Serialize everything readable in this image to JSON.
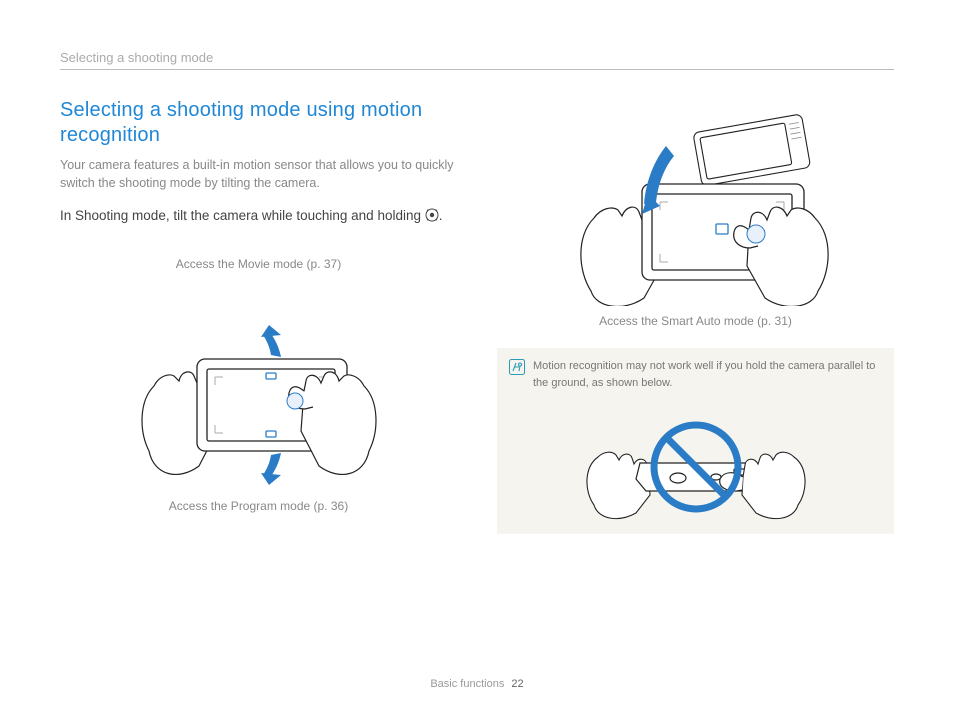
{
  "header": {
    "running_title": "Selecting a shooting mode"
  },
  "section": {
    "title": "Selecting a shooting mode using motion recognition",
    "intro": "Your camera features a built-in motion sensor that allows you to quickly switch the shooting mode by tilting the camera.",
    "instruction_pre": "In Shooting mode, tilt the camera while touching and holding ",
    "instruction_post": ".",
    "mode_icon": "motion-mode-icon"
  },
  "figures": {
    "movie_caption": "Access the Movie mode (p. 37)",
    "program_caption": "Access the Program mode (p. 36)",
    "smartauto_caption": "Access the Smart Auto mode (p. 31)"
  },
  "note": {
    "text": "Motion recognition may not work well if you hold the camera parallel to the ground, as shown below."
  },
  "footer": {
    "section": "Basic functions",
    "page": "22"
  },
  "colors": {
    "accent": "#1f87d6",
    "arrow": "#2a7cc7",
    "prohibit": "#2a7cc7"
  }
}
